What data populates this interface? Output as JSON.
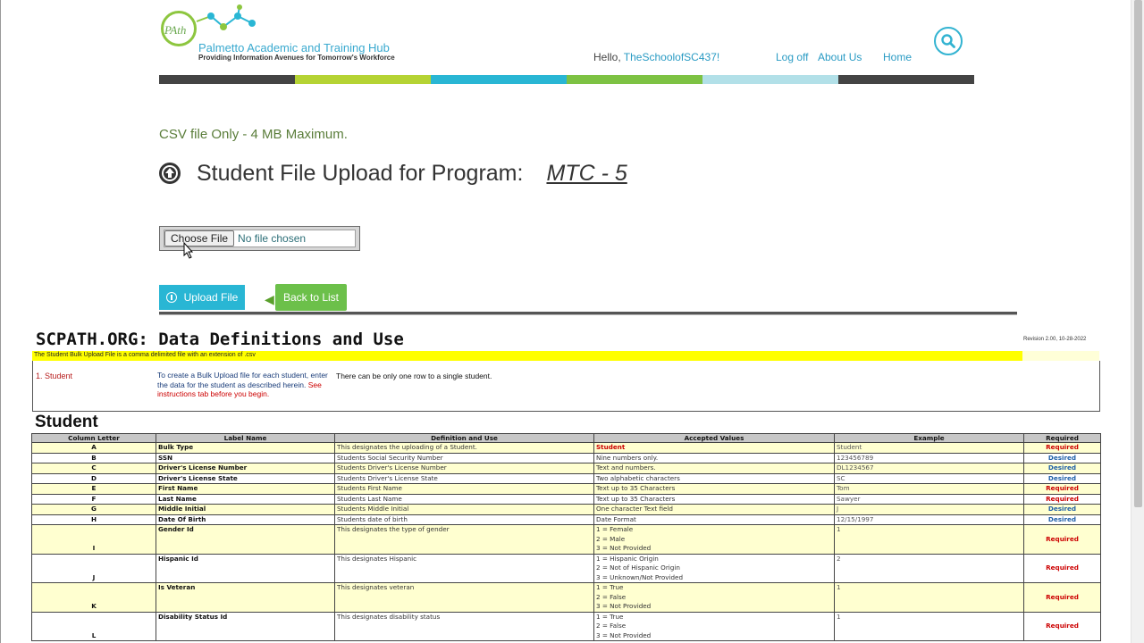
{
  "header": {
    "logo_mark": "PAth",
    "logo_title": "Palmetto Academic and Training Hub",
    "logo_tagline": "Providing Information Avenues for Tomorrow's Workforce",
    "greeting": "Hello, ",
    "username": "TheSchoolofSC437!",
    "nav": [
      "Log off",
      "About Us",
      "Home"
    ],
    "search_icon": "search-icon",
    "color_bar": [
      "#444444",
      "#b5d334",
      "#29b6d4",
      "#7dc243",
      "#b2e0e8",
      "#444444"
    ]
  },
  "upload": {
    "csv_note": "CSV file Only - 4 MB Maximum.",
    "title": "Student File Upload for Program:",
    "program": "MTC - 5",
    "choose_file": "Choose File",
    "no_file": "No file chosen",
    "upload_button": "Upload File",
    "back_button": "Back to List"
  },
  "sheet": {
    "title": "SCPATH.ORG: Data Definitions and Use",
    "revision": "Revision 2.00, 10-28-2022",
    "banner": "The Student Bulk Upload File is a comma delimited file with an extension of .csv",
    "student_link": "1. Student",
    "student_desc_1": "To create a Bulk Upload file for each student, enter the data for the student as described herein.",
    "student_desc_2": "See instructions tab before you begin.",
    "student_note": "There can be only one row to a single student.",
    "section_title": "Student",
    "columns": [
      "Column Letter",
      "Label Name",
      "Definition and Use",
      "Accepted Values",
      "Example",
      "Required"
    ],
    "rows": [
      {
        "letter": "A",
        "label": "Bulk Type",
        "definition": "This designates the uploading of a Student.",
        "accepted": [
          "Student"
        ],
        "example": "Student",
        "required": "Required"
      },
      {
        "letter": "B",
        "label": "SSN",
        "definition": "Students Social Security Number",
        "accepted": [
          "Nine numbers only."
        ],
        "example": "123456789",
        "required": "Desired"
      },
      {
        "letter": "C",
        "label": "Driver's License Number",
        "definition": "Students Driver's License Number",
        "accepted": [
          "Text and numbers."
        ],
        "example": "DL1234567",
        "required": "Desired"
      },
      {
        "letter": "D",
        "label": "Driver's License State",
        "definition": "Students Driver's License State",
        "accepted": [
          "Two alphabetic characters"
        ],
        "example": "SC",
        "required": "Desired"
      },
      {
        "letter": "E",
        "label": "First Name",
        "definition": "Students First Name",
        "accepted": [
          "Text up to 35 Characters"
        ],
        "example": "Tom",
        "required": "Required"
      },
      {
        "letter": "F",
        "label": "Last Name",
        "definition": "Students Last Name",
        "accepted": [
          "Text up to 35 Characters"
        ],
        "example": "Sawyer",
        "required": "Required"
      },
      {
        "letter": "G",
        "label": "Middle Initial",
        "definition": "Students Middle Initial",
        "accepted": [
          "One character Text field"
        ],
        "example": "J",
        "required": "Desired"
      },
      {
        "letter": "H",
        "label": "Date Of Birth",
        "definition": "Students date of birth",
        "accepted": [
          "Date Format"
        ],
        "example": "12/15/1997",
        "required": "Desired"
      },
      {
        "letter": "I",
        "label": "Gender Id",
        "definition": "This designates the type of gender",
        "accepted": [
          "1 = Female",
          "2 = Male",
          "3 = Not Provided"
        ],
        "example": "1",
        "required": "Required"
      },
      {
        "letter": "J",
        "label": "Hispanic Id",
        "definition": "This designates Hispanic",
        "accepted": [
          "1 = Hispanic Origin",
          "2 = Not of Hispanic Origin",
          "3 = Unknown/Not Provided"
        ],
        "example": "2",
        "required": "Required"
      },
      {
        "letter": "K",
        "label": "Is Veteran",
        "definition": "This designates veteran",
        "accepted": [
          "1 = True",
          "2 = False",
          "3 = Not Provided"
        ],
        "example": "1",
        "required": "Required"
      },
      {
        "letter": "L",
        "label": "Disability Status Id",
        "definition": "This designates disability status",
        "accepted": [
          "1 = True",
          "2 = False",
          "3 = Not Provided"
        ],
        "example": "1",
        "required": "Required"
      }
    ]
  }
}
